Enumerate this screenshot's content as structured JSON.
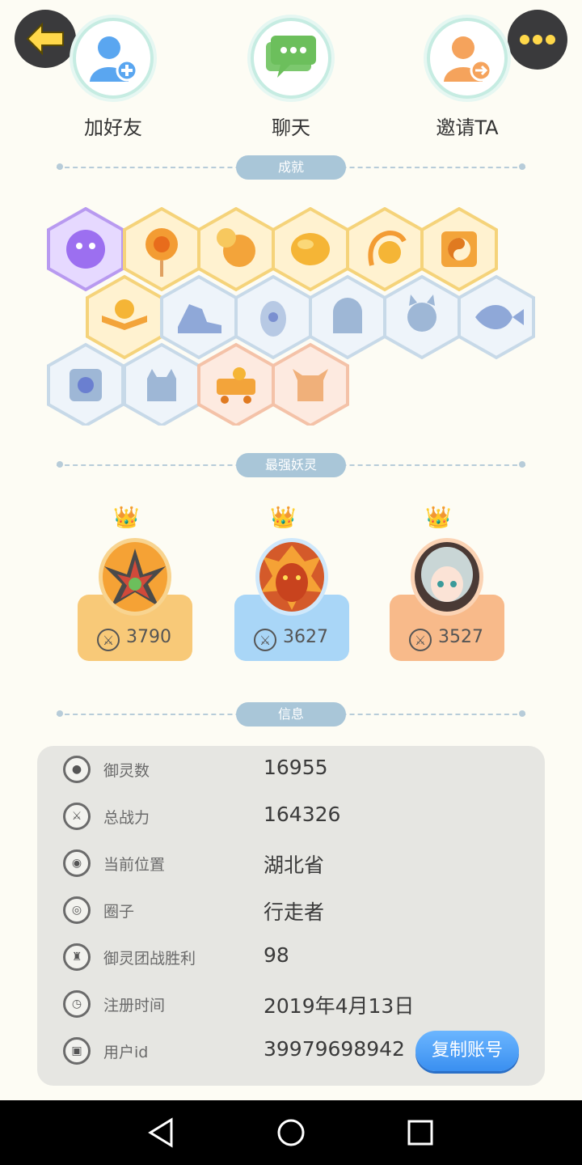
{
  "header": {
    "actions": [
      {
        "label": "加好友",
        "icon": "add-friend-icon"
      },
      {
        "label": "聊天",
        "icon": "chat-icon"
      },
      {
        "label": "邀请TA",
        "icon": "invite-icon"
      }
    ]
  },
  "sections": {
    "achievements": "成就",
    "strongest": "最强妖灵",
    "info": "信息"
  },
  "achievements": {
    "row1": [
      "purple-cat-badge",
      "sun-lollipop-badge",
      "moon-badge",
      "golden-orb-badge",
      "phoenix-coin-badge",
      "yin-yang-badge"
    ],
    "row2": [
      "book-badge",
      "sneaker-badge",
      "egg-badge",
      "ghost-badge",
      "cat-spirit-badge",
      "fish-badge"
    ],
    "row3": [
      "shield-badge",
      "cat-silhouette-badge",
      "cart-badge",
      "demon-badge"
    ]
  },
  "spirits": [
    {
      "score": "3790",
      "color": "#f7c56e"
    },
    {
      "score": "3627",
      "color": "#a8d4f5"
    },
    {
      "score": "3527",
      "color": "#f7b888"
    }
  ],
  "info": {
    "rows": [
      {
        "key": "御灵数",
        "value": "16955",
        "icon": "spirit-count-icon"
      },
      {
        "key": "总战力",
        "value": "164326",
        "icon": "sword-icon"
      },
      {
        "key": "当前位置",
        "value": "湖北省",
        "icon": "location-icon"
      },
      {
        "key": "圈子",
        "value": "行走者",
        "icon": "circle-icon"
      },
      {
        "key": "御灵团战胜利",
        "value": "98",
        "icon": "trophy-icon"
      },
      {
        "key": "注册时间",
        "value": "2019年4月13日",
        "icon": "clock-icon"
      },
      {
        "key": "用户id",
        "value": "39979698942",
        "icon": "id-icon"
      }
    ],
    "copy_label": "复制账号"
  }
}
